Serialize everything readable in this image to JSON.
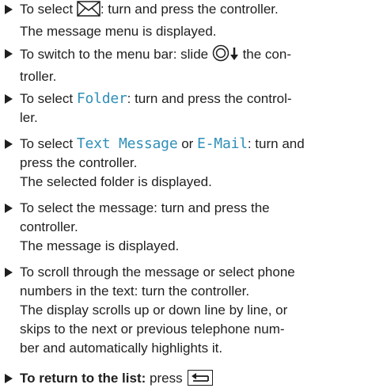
{
  "steps": [
    {
      "lines": [
        {
          "pre": "To select ",
          "post": ": turn and press the controller."
        },
        {
          "text": "The message menu is displayed."
        }
      ],
      "icon": "envelope-icon"
    },
    {
      "lines": [
        {
          "pre": "To switch to the menu bar: slide ",
          "post": " the con-"
        },
        {
          "text": "troller."
        }
      ],
      "icon": "controller-slide-down-icon"
    },
    {
      "lines": [
        {
          "pre": "To select ",
          "term": "Folder",
          "post": ": turn and press the control-"
        },
        {
          "text": "ler."
        }
      ]
    },
    {
      "lines": [
        {
          "pre": "To select ",
          "term1": "Text Message",
          "mid": " or ",
          "term2": "E-Mail",
          "post": ": turn and"
        },
        {
          "text": "press the controller."
        },
        {
          "text": "The selected folder is displayed."
        }
      ]
    },
    {
      "lines": [
        {
          "text": "To select the message: turn and press the"
        },
        {
          "text": "controller."
        },
        {
          "text": "The message is displayed."
        }
      ]
    },
    {
      "lines": [
        {
          "text": "To scroll through the message or select phone"
        },
        {
          "text": "numbers in the text: turn the controller."
        },
        {
          "text": "The display scrolls up or down line by line, or"
        },
        {
          "text": "skips to the next or previous telephone num-"
        },
        {
          "text": "ber and automatically highlights it."
        }
      ]
    },
    {
      "lines": [
        {
          "bold": "To return to the list:",
          "post": " press "
        }
      ],
      "icon": "back-button-icon"
    }
  ]
}
